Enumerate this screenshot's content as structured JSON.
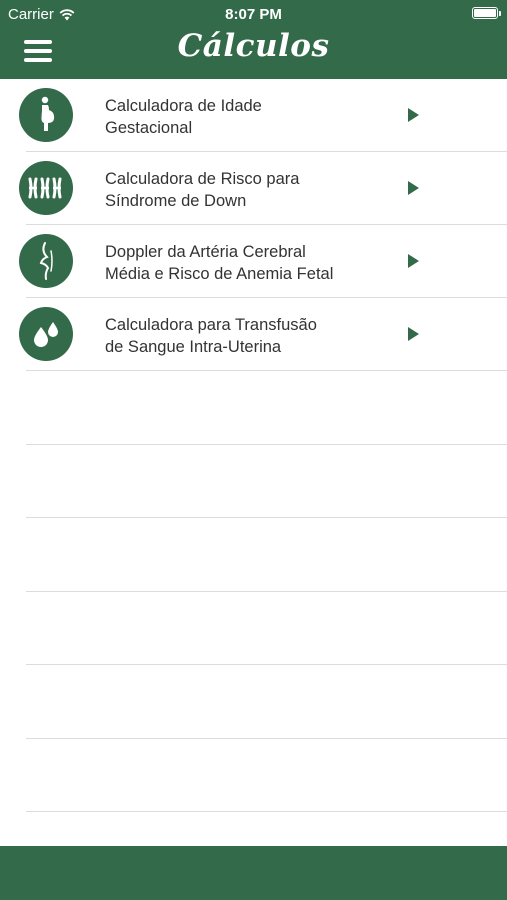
{
  "status_bar": {
    "carrier": "Carrier",
    "time": "8:07 PM",
    "battery_level": 1.0
  },
  "header": {
    "title": "Cálculos",
    "menu_icon": "hamburger-menu-icon"
  },
  "calculators": [
    {
      "line1": "Calculadora de Idade",
      "line2": "Gestacional",
      "icon": "pregnant-woman-icon"
    },
    {
      "line1": "Calculadora de Risco para",
      "line2": "Síndrome de Down",
      "icon": "chromosomes-icon"
    },
    {
      "line1": "Doppler da Artéria Cerebral",
      "line2": "Média e Risco de Anemia Fetal",
      "icon": "fetal-doppler-icon"
    },
    {
      "line1": "Calculadora para Transfusão",
      "line2": "de Sangue Intra-Uterina",
      "icon": "blood-drops-icon"
    }
  ],
  "colors": {
    "brand_green": "#336b4a",
    "divider": "#dcdcdc",
    "text": "#333333",
    "background": "#ffffff"
  }
}
